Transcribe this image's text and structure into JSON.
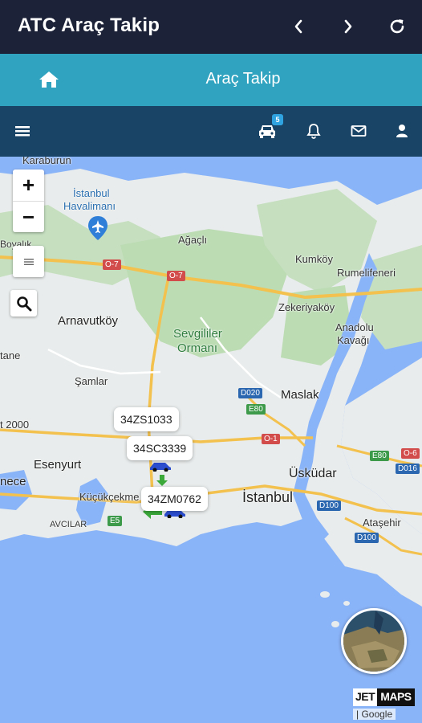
{
  "app": {
    "title": "ATC Araç Takip"
  },
  "header": {
    "page_title": "Araç Takip"
  },
  "navbar": {
    "vehicle_badge": "5"
  },
  "map": {
    "zoom_in": "+",
    "zoom_out": "−",
    "places": {
      "karaburun": "Karaburun",
      "istanbul_havalimani_1": "İstanbul",
      "istanbul_havalimani_2": "Havalimanı",
      "agacli": "Ağaçlı",
      "kumkoy": "Kumköy",
      "rumelifeneri": "Rumelifeneri",
      "zekeriyakoy": "Zekeriyaköy",
      "arnavutkoy": "Arnavutköy",
      "sevgililer_1": "Sevgililer",
      "sevgililer_2": "Ormanı",
      "anadolu_1": "Anadolu",
      "anadolu_2": "Kavağı",
      "boyalik": "Boyalık",
      "tane": "tane",
      "samlar": "Şamlar",
      "maslak": "Maslak",
      "t2000": "t 2000",
      "esenyurt": "Esenyurt",
      "uskudar": "Üsküdar",
      "istanbul": "İstanbul",
      "necе": "nece",
      "kucukcekme": "Küçükçekme",
      "avcilar": "AVCILAR",
      "atasehir": "Ataşehir"
    },
    "roads": {
      "o7a": "O-7",
      "o7b": "O-7",
      "d020": "D020",
      "e80a": "E80",
      "o1": "O-1",
      "e80b": "E80",
      "o6": "O-6",
      "d016": "D016",
      "d100a": "D100",
      "d100b": "D100",
      "e5": "E5"
    },
    "vehicles": [
      {
        "plate": "34ZS1033"
      },
      {
        "plate": "34SC3339"
      },
      {
        "plate": "34ZM0762"
      }
    ],
    "brand_jet": "JET",
    "brand_maps": "MAPS",
    "attribution": "| Google"
  }
}
